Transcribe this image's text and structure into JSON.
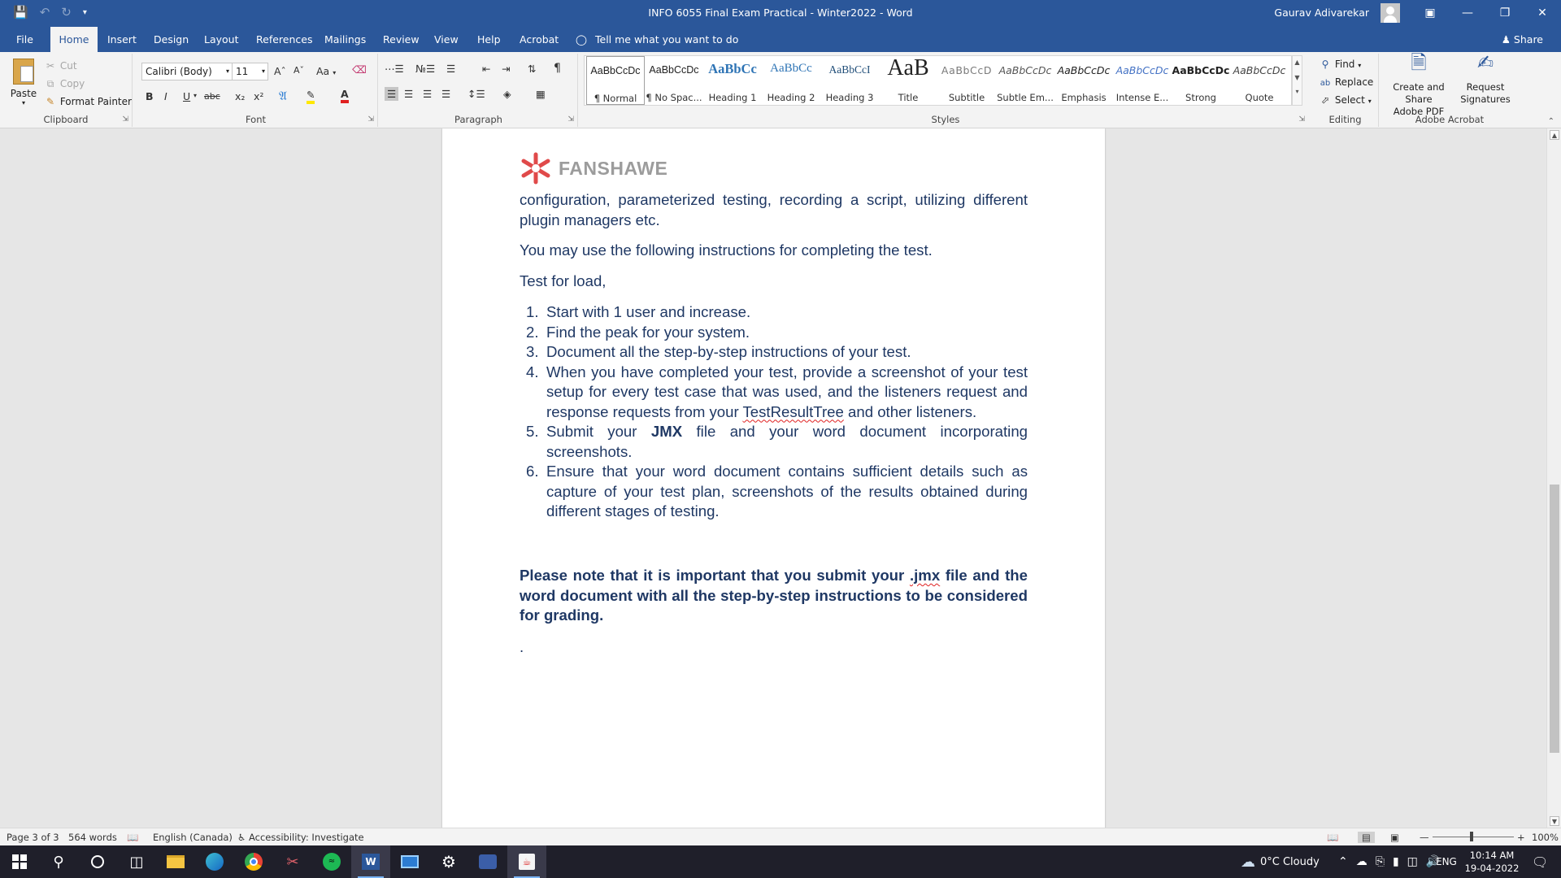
{
  "titlebar": {
    "doc_title": "INFO 6055 Final Exam Practical - Winter2022  -  Word",
    "user_name": "Gaurav Adivarekar"
  },
  "tabs": [
    "File",
    "Home",
    "Insert",
    "Design",
    "Layout",
    "References",
    "Mailings",
    "Review",
    "View",
    "Help",
    "Acrobat"
  ],
  "active_tab": "Home",
  "tell_me": "Tell me what you want to do",
  "share": "Share",
  "ribbon": {
    "clipboard": {
      "paste": "Paste",
      "cut": "Cut",
      "copy": "Copy",
      "format_painter": "Format Painter",
      "label": "Clipboard"
    },
    "font": {
      "name": "Calibri (Body)",
      "size": "11",
      "label": "Font",
      "bold": "B",
      "italic": "I",
      "underline": "U",
      "strike": "abc",
      "sub": "x₂",
      "sup": "x²",
      "grow": "Aˆ",
      "shrink": "Aˇ",
      "case": "Aa"
    },
    "paragraph": {
      "label": "Paragraph"
    },
    "styles": {
      "label": "Styles",
      "items": [
        {
          "preview": "AaBbCcDc",
          "name": "¶ Normal"
        },
        {
          "preview": "AaBbCcDc",
          "name": "¶ No Spac..."
        },
        {
          "preview": "AaBbCc",
          "name": "Heading 1"
        },
        {
          "preview": "AaBbCc",
          "name": "Heading 2"
        },
        {
          "preview": "AaBbCcI",
          "name": "Heading 3"
        },
        {
          "preview": "AaB",
          "name": "Title"
        },
        {
          "preview": "AaBbCcD",
          "name": "Subtitle"
        },
        {
          "preview": "AaBbCcDc",
          "name": "Subtle Em..."
        },
        {
          "preview": "AaBbCcDc",
          "name": "Emphasis"
        },
        {
          "preview": "AaBbCcDc",
          "name": "Intense E..."
        },
        {
          "preview": "AaBbCcDc",
          "name": "Strong"
        },
        {
          "preview": "AaBbCcDc",
          "name": "Quote"
        }
      ]
    },
    "editing": {
      "find": "Find",
      "replace": "Replace",
      "select": "Select",
      "label": "Editing"
    },
    "acrobat": {
      "create_line1": "Create and Share",
      "create_line2": "Adobe PDF",
      "request_line1": "Request",
      "request_line2": "Signatures",
      "label": "Adobe Acrobat"
    }
  },
  "document": {
    "logo_text": "FANSHAWE",
    "para1": "configuration, parameterized testing, recording a script, utilizing different plugin managers etc.",
    "para2": "You may use the following instructions for completing the test.",
    "para3": "Test for load,",
    "list": [
      {
        "num": "1.",
        "text": "Start with 1 user and increase."
      },
      {
        "num": "2.",
        "text": "Find the peak for your system."
      },
      {
        "num": "3.",
        "text": "Document all the step-by-step instructions of your test."
      },
      {
        "num": "4.",
        "text_a": "When you have completed your test, provide a screenshot of your test setup for every test case that was used, and the listeners request and response requests from your ",
        "link": "TestResultTree",
        "text_b": " and other listeners."
      },
      {
        "num": "5.",
        "text_a": "Submit your ",
        "bold": "JMX",
        "text_b": " file and your word document incorporating screenshots."
      },
      {
        "num": "6.",
        "text": "Ensure that your word document contains sufficient details such as capture of your test plan, screenshots of the results obtained during different stages of testing."
      }
    ],
    "note_a": "Please note that it is important that you submit your ",
    "note_spell": ".jmx",
    "note_b": " file and the word document with all the step-by-step instructions to be considered for grading.",
    "dot": "."
  },
  "status": {
    "page": "Page 3 of 3",
    "words": "564 words",
    "language": "English (Canada)",
    "accessibility": "Accessibility: Investigate",
    "zoom": "100%"
  },
  "taskbar": {
    "weather": "0°C  Cloudy",
    "lang": "ENG",
    "time": "10:14 AM",
    "date": "19-04-2022"
  },
  "colors": {
    "word_blue": "#2b579a",
    "doc_text": "#1f3864",
    "logo_red": "#e04a4a"
  }
}
